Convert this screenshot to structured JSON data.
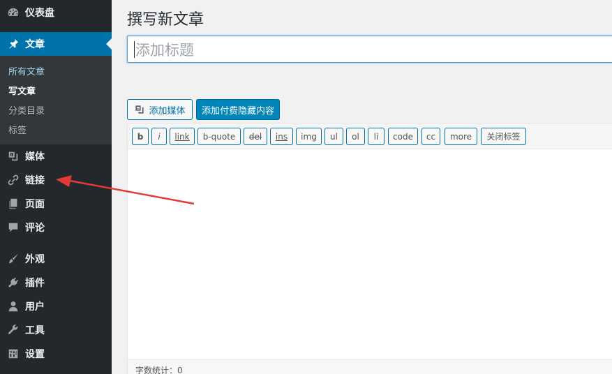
{
  "sidebar": {
    "items": [
      {
        "label": "仪表盘",
        "icon": "dashboard-icon"
      },
      {
        "label": "文章",
        "icon": "pin-icon",
        "active": true
      },
      {
        "label": "媒体",
        "icon": "media-icon"
      },
      {
        "label": "链接",
        "icon": "link-icon"
      },
      {
        "label": "页面",
        "icon": "page-icon"
      },
      {
        "label": "评论",
        "icon": "comment-icon"
      },
      {
        "label": "外观",
        "icon": "brush-icon"
      },
      {
        "label": "插件",
        "icon": "plugin-icon"
      },
      {
        "label": "用户",
        "icon": "user-icon"
      },
      {
        "label": "工具",
        "icon": "wrench-icon"
      },
      {
        "label": "设置",
        "icon": "settings-icon"
      }
    ],
    "submenu": [
      "所有文章",
      "写文章",
      "分类目录",
      "标签"
    ]
  },
  "main": {
    "page_title": "撰写新文章",
    "title_placeholder": "添加标题",
    "add_media_label": "添加媒体",
    "paid_hidden_label": "添加付费隐藏内容",
    "toolbar": [
      "b",
      "i",
      "link",
      "b-quote",
      "del",
      "ins",
      "img",
      "ul",
      "ol",
      "li",
      "code",
      "cc",
      "more",
      "关闭标签"
    ],
    "word_count": "字数统计：0"
  },
  "colors": {
    "sidebar_bg": "#23282d",
    "active_bg": "#0073aa",
    "primary_button": "#0085ba",
    "annotation_arrow": "#e53935"
  }
}
